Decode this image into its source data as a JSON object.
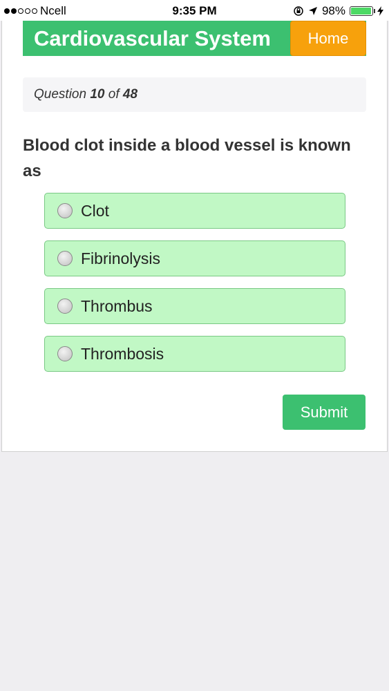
{
  "status_bar": {
    "carrier": "Ncell",
    "time": "9:35 PM",
    "battery": "98%",
    "battery_level": 0.98,
    "icons": [
      "signal-dots-icon",
      "orientation-lock-icon",
      "location-arrow-icon",
      "battery-icon",
      "charging-bolt-icon"
    ]
  },
  "header": {
    "title": "Cardiovascular System",
    "home_label": "Home"
  },
  "counter": {
    "prefix": "Question",
    "current": "10",
    "separator": "of",
    "total": "48"
  },
  "question": {
    "text": "Blood clot inside a blood vessel is known as"
  },
  "options": [
    {
      "label": "Clot"
    },
    {
      "label": "Fibrinolysis"
    },
    {
      "label": "Thrombus"
    },
    {
      "label": "Thrombosis"
    }
  ],
  "submit_label": "Submit",
  "colors": {
    "header_green": "#3cc070",
    "home_orange": "#f7a10c",
    "option_bg": "#c1f8c5",
    "option_border": "#79c884"
  }
}
